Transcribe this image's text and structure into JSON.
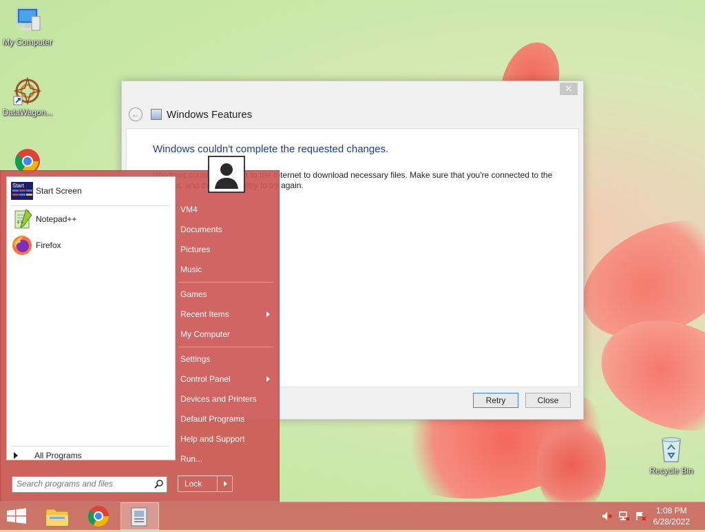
{
  "desktop": {
    "icons": [
      {
        "label": "My Computer"
      },
      {
        "label": "DataWagon..."
      },
      {
        "label": ""
      },
      {
        "label": "Recycle Bin"
      }
    ]
  },
  "dialog": {
    "title": "Windows Features",
    "heading": "Windows couldn't complete the requested changes.",
    "message": "Windows couldn't connect to the Internet to download necessary files. Make sure that you're connected to the Internet, and then click Retry to try again.",
    "retry_label": "Retry",
    "close_label": "Close",
    "close_glyph": "✕"
  },
  "start_menu": {
    "pinned": [
      {
        "label": "Start Screen",
        "icon": "start-screen-icon"
      },
      {
        "label": "Notepad++",
        "icon": "notepadpp-icon"
      },
      {
        "label": "Firefox",
        "icon": "firefox-icon"
      }
    ],
    "start_tile_text": "Start",
    "all_programs_label": "All Programs",
    "search_placeholder": "Search programs and files",
    "right_items": [
      {
        "label": "VM4"
      },
      {
        "label": "Documents"
      },
      {
        "label": "Pictures"
      },
      {
        "label": "Music"
      },
      {
        "label": "Games"
      },
      {
        "label": "Recent Items"
      },
      {
        "label": "My Computer"
      },
      {
        "label": "Settings"
      },
      {
        "label": "Control Panel"
      },
      {
        "label": "Devices and Printers"
      },
      {
        "label": "Default Programs"
      },
      {
        "label": "Help and Support"
      },
      {
        "label": "Run..."
      }
    ],
    "lock_label": "Lock"
  },
  "taskbar": {
    "time": "1:08 PM",
    "date": "6/28/2022"
  }
}
